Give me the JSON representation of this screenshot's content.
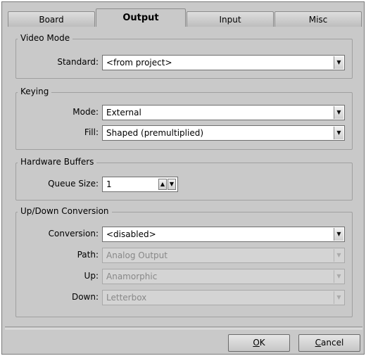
{
  "tabs": [
    "Board",
    "Output",
    "Input",
    "Misc"
  ],
  "active_tab": "Output",
  "groups": {
    "video_mode": {
      "title": "Video Mode",
      "standard_label": "Standard:",
      "standard_value": "<from project>"
    },
    "keying": {
      "title": "Keying",
      "mode_label": "Mode:",
      "mode_value": "External",
      "fill_label": "Fill:",
      "fill_value": "Shaped (premultiplied)"
    },
    "hardware_buffers": {
      "title": "Hardware Buffers",
      "queue_label": "Queue Size:",
      "queue_value": "1"
    },
    "conversion": {
      "title": "Up/Down Conversion",
      "conversion_label": "Conversion:",
      "conversion_value": "<disabled>",
      "path_label": "Path:",
      "path_value": "Analog Output",
      "up_label": "Up:",
      "up_value": "Anamorphic",
      "down_label": "Down:",
      "down_value": "Letterbox"
    }
  },
  "buttons": {
    "ok_mnemonic": "O",
    "ok_rest": "K",
    "cancel_mnemonic": "C",
    "cancel_rest": "ancel"
  }
}
